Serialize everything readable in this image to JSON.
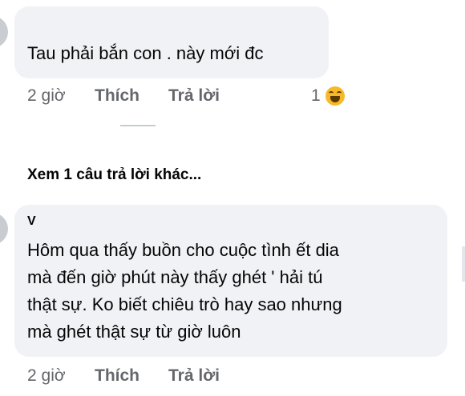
{
  "comments": [
    {
      "author": "",
      "text_lines": [
        "Tau phải bắn con . này mới đc"
      ],
      "time": "2 giờ",
      "like_label": "Thích",
      "reply_label": "Trả lời",
      "reaction_count": "1",
      "reaction_icon": "haha-icon"
    },
    {
      "author": "V",
      "text_lines": [
        "Hôm qua thấy buồn cho cuộc tình ết dia",
        "mà đến giờ phút này thấy ghét  ' hải tú",
        "thật sự. Ko biết chiêu trò hay sao nhưng",
        "mà ghét thật sự từ giờ luôn"
      ],
      "time": "2 giờ",
      "like_label": "Thích",
      "reply_label": "Trả lời"
    }
  ],
  "more_replies": "Xem 1 câu trả lời khác...",
  "colors": {
    "bubble": "#f0f2f5",
    "meta_text": "#65676b",
    "body_text": "#050505",
    "haha": "#f7b928"
  }
}
